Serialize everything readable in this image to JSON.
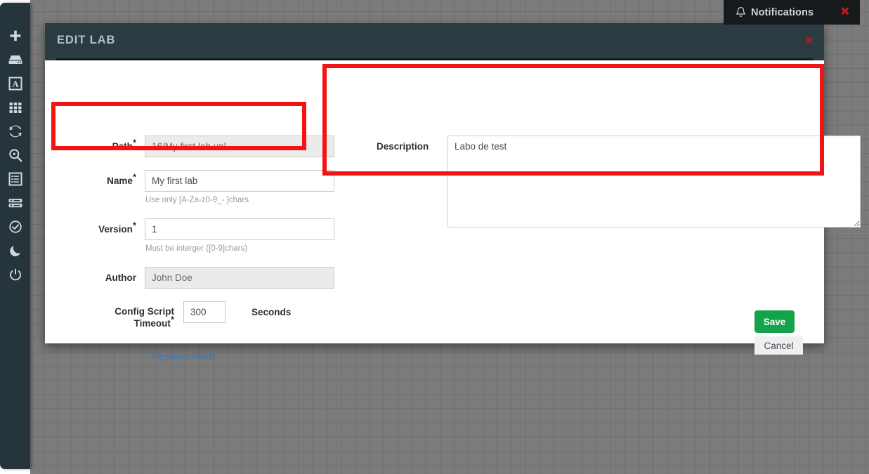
{
  "notifications": {
    "label": "Notifications",
    "bell_icon": "bell-icon",
    "close_label": "✖",
    "background": "#161a1d",
    "close_color": "#b01a1a"
  },
  "sidebar": {
    "background": "#26353b",
    "items": [
      {
        "icon": "plus-icon",
        "name": "add"
      },
      {
        "icon": "hard-drive-icon",
        "name": "storage"
      },
      {
        "icon": "text-box-icon",
        "name": "text"
      },
      {
        "icon": "grid-icon",
        "name": "grid"
      },
      {
        "icon": "refresh-icon",
        "name": "refresh"
      },
      {
        "icon": "search-zoom-icon",
        "name": "search"
      },
      {
        "icon": "list-box-icon",
        "name": "logs"
      },
      {
        "icon": "server-stack-icon",
        "name": "nodes"
      },
      {
        "icon": "check-circle-icon",
        "name": "status"
      },
      {
        "icon": "moon-icon",
        "name": "night-mode"
      },
      {
        "icon": "power-icon",
        "name": "power"
      }
    ]
  },
  "modal": {
    "title": "EDIT LAB",
    "title_color": "#a9c2cf",
    "header_background": "#2a3b42",
    "close_label": "✖",
    "close_color": "#9b2222",
    "fields": {
      "path": {
        "label": "Path",
        "required": true,
        "value": "16/My first lab.unl",
        "placeholder": "",
        "disabled": true
      },
      "name": {
        "label": "Name",
        "required": true,
        "value": "My first lab",
        "placeholder": "",
        "hint": "Use only [A-Za-z0-9_- ]chars",
        "disabled": false
      },
      "version": {
        "label": "Version",
        "required": true,
        "value": "1",
        "placeholder": "",
        "hint": "Must be interger ([0-9]chars)",
        "disabled": false
      },
      "author": {
        "label": "Author",
        "required": false,
        "value": "John Doe",
        "placeholder": "",
        "disabled": true
      },
      "timeout": {
        "label": "Config Script Timeout",
        "required": true,
        "value": "300",
        "unit": "Seconds"
      },
      "description": {
        "label": "Description",
        "required": false,
        "value": "Labo de test",
        "placeholder": ""
      }
    },
    "required_note": {
      "star": "*",
      "text": "- Required Fields",
      "color": "#3a7ab8"
    },
    "buttons": {
      "save": {
        "label": "Save",
        "color": "#14a34a"
      },
      "cancel": {
        "label": "Cancel",
        "color": "#efefef"
      }
    }
  },
  "annotations": {
    "color": "#f41313",
    "boxes": [
      {
        "target": "name-field"
      },
      {
        "target": "description-field"
      }
    ]
  }
}
